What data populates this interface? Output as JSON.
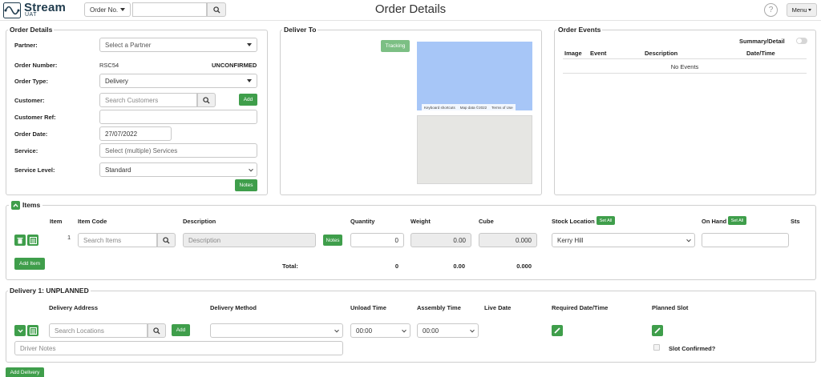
{
  "header": {
    "logo_text": "Stream",
    "logo_sub": "UAT",
    "search_type": "Order No.",
    "search_value": "",
    "title": "Order Details",
    "help": "?",
    "menu": "Menu"
  },
  "order_details": {
    "legend": "Order Details",
    "partner_label": "Partner:",
    "partner_placeholder": "Select a Partner",
    "order_number_label": "Order Number:",
    "order_number": "RSC54",
    "status": "UNCONFIRMED",
    "order_type_label": "Order Type:",
    "order_type": "Delivery",
    "customer_label": "Customer:",
    "customer_placeholder": "Search Customers",
    "add_label": "Add",
    "customer_ref_label": "Customer Ref:",
    "customer_ref": "",
    "order_date_label": "Order Date:",
    "order_date": "27/07/2022",
    "service_label": "Service:",
    "service_placeholder": "Select (multiple) Services",
    "service_level_label": "Service Level:",
    "service_level": "Standard",
    "notes_label": "Notes"
  },
  "deliver_to": {
    "legend": "Deliver To",
    "tracking_label": "Tracking",
    "map_footer": [
      "Keyboard shortcuts",
      "Map data ©2022",
      "Terms of Use"
    ]
  },
  "order_events": {
    "legend": "Order Events",
    "toggle_label": "Summary/Detail",
    "columns": [
      "Image",
      "Event",
      "Description",
      "Date/Time"
    ],
    "empty": "No Events"
  },
  "items": {
    "legend": "Items",
    "columns": {
      "item": "Item",
      "item_code": "Item Code",
      "description": "Description",
      "quantity": "Quantity",
      "weight": "Weight",
      "cube": "Cube",
      "stock_location": "Stock Location",
      "on_hand": "On Hand",
      "sts": "Sts"
    },
    "set_all": "Set All",
    "row": {
      "number": "1",
      "item_placeholder": "Search Items",
      "description_placeholder": "Description",
      "notes": "Notes",
      "quantity": "0",
      "weight": "0.00",
      "cube": "0.000",
      "stock_location": "Kerry Hill",
      "on_hand": ""
    },
    "add_item": "Add Item",
    "total_label": "Total:",
    "total_quantity": "0",
    "total_weight": "0.00",
    "total_cube": "0.000"
  },
  "delivery": {
    "legend": "Delivery 1: UNPLANNED",
    "columns": {
      "address": "Delivery Address",
      "method": "Delivery Method",
      "unload": "Unload Time",
      "assembly": "Assembly Time",
      "live_date": "Live Date",
      "required": "Required Date/Time",
      "planned": "Planned Slot"
    },
    "location_placeholder": "Search Locations",
    "add_label": "Add",
    "method": "",
    "unload_time": "00:00",
    "assembly_time": "00:00",
    "driver_notes_placeholder": "Driver Notes",
    "slot_confirmed": "Slot Confirmed?"
  },
  "add_delivery": "Add Delivery",
  "colors": {
    "accent_green": "#3f9e4b",
    "map_blue": "#a7c6f7",
    "logo_navy": "#1f3b4d"
  }
}
